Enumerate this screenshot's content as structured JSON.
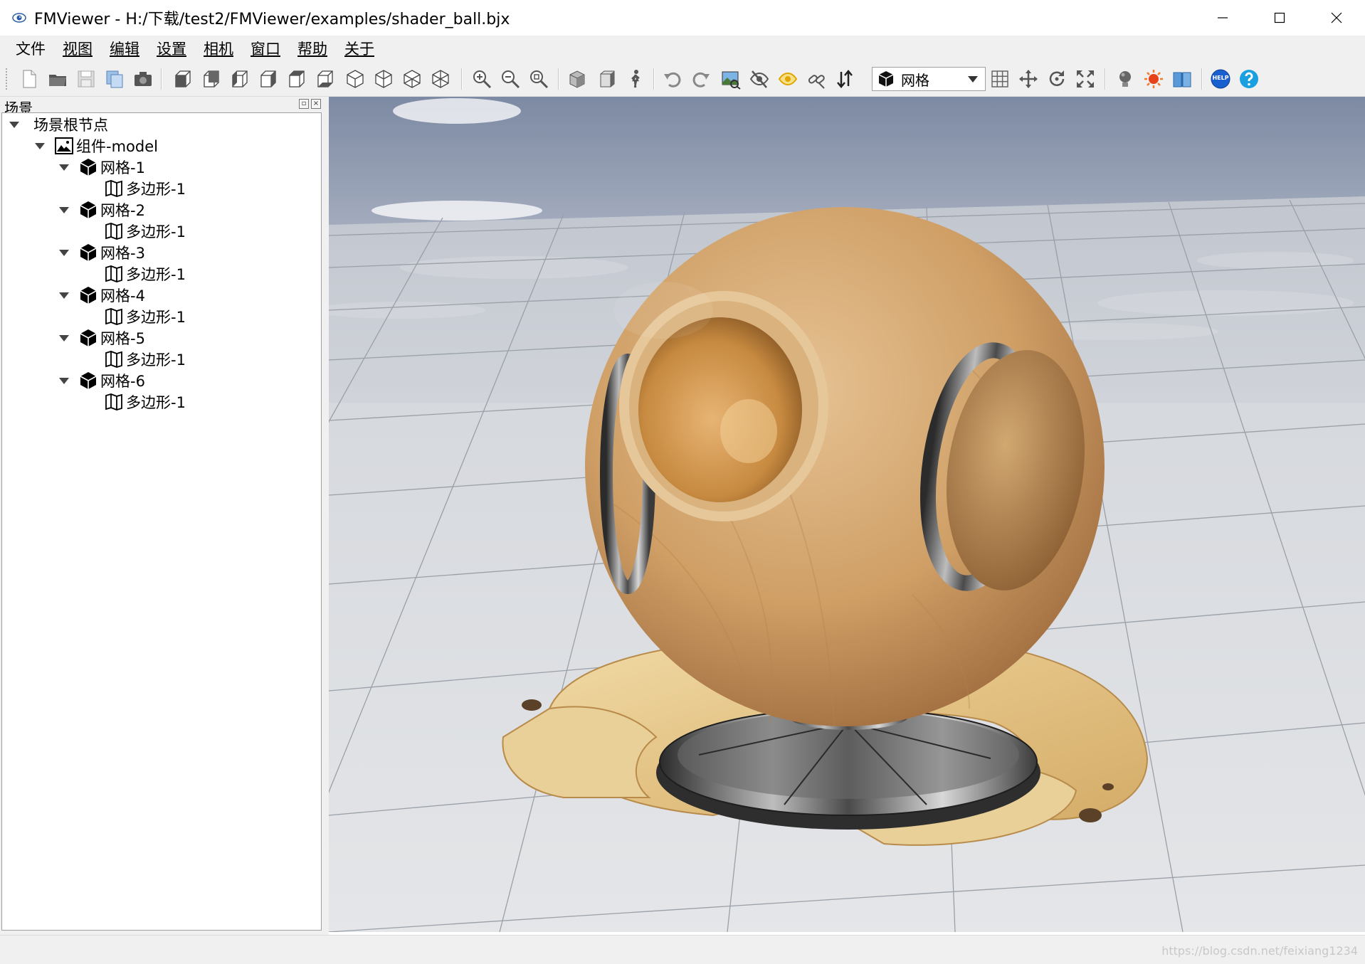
{
  "window": {
    "title": "FMViewer - H:/下载/test2/FMViewer/examples/shader_ball.bjx",
    "controls": [
      "minimize",
      "maximize",
      "close"
    ]
  },
  "menu": [
    {
      "label": "文件",
      "icon": null
    },
    {
      "label": "视图",
      "icon": null
    },
    {
      "label": "编辑",
      "icon": null
    },
    {
      "label": "设置",
      "icon": null
    },
    {
      "label": "相机",
      "icon": null
    },
    {
      "label": "窗口",
      "icon": null
    },
    {
      "label": "帮助",
      "icon": null
    },
    {
      "label": "关于",
      "icon": null
    }
  ],
  "toolbar": {
    "file_tools": [
      "new-file-icon",
      "open-folder-icon",
      "save-icon",
      "copy-icon",
      "screenshot-icon"
    ],
    "view_tools": [
      "view-front-icon",
      "view-back-icon",
      "view-left-icon",
      "view-right-icon",
      "view-top-icon",
      "view-bottom-icon",
      "view-iso-1-icon",
      "view-iso-2-icon",
      "view-iso-3-icon",
      "view-iso-4-icon"
    ],
    "zoom_tools": [
      "zoom-in-icon",
      "zoom-out-icon",
      "zoom-fit-icon"
    ],
    "mode_select": {
      "label": "网格",
      "icon": "mesh-cube-icon"
    },
    "help_badge": "HELP"
  },
  "scene_panel": {
    "title": "场景",
    "tree": [
      {
        "level": 0,
        "label": "场景根节点",
        "icon": null,
        "expanded": true
      },
      {
        "level": 1,
        "label": "组件-model",
        "icon": "image-icon",
        "expanded": true
      },
      {
        "level": 2,
        "label": "网格-1",
        "icon": "cube-icon",
        "expanded": true
      },
      {
        "level": 3,
        "label": "多边形-1",
        "icon": "map-icon"
      },
      {
        "level": 2,
        "label": "网格-2",
        "icon": "cube-icon",
        "expanded": true
      },
      {
        "level": 3,
        "label": "多边形-1",
        "icon": "map-icon"
      },
      {
        "level": 2,
        "label": "网格-3",
        "icon": "cube-icon",
        "expanded": true
      },
      {
        "level": 3,
        "label": "多边形-1",
        "icon": "map-icon"
      },
      {
        "level": 2,
        "label": "网格-4",
        "icon": "cube-icon",
        "expanded": true
      },
      {
        "level": 3,
        "label": "多边形-1",
        "icon": "map-icon"
      },
      {
        "level": 2,
        "label": "网格-5",
        "icon": "cube-icon",
        "expanded": true
      },
      {
        "level": 3,
        "label": "多边形-1",
        "icon": "map-icon"
      },
      {
        "level": 2,
        "label": "网格-6",
        "icon": "cube-icon",
        "expanded": true
      },
      {
        "level": 3,
        "label": "多边形-1",
        "icon": "map-icon"
      }
    ]
  },
  "statusbar": {
    "watermark": "https://blog.csdn.net/feixiang1234"
  },
  "colors": {
    "wood": "#d2a46a",
    "wood_dark": "#a87a44",
    "base_wood": "#e8cf9a",
    "chrome": "#5a5a5a",
    "sky": "#8a96ae",
    "ground": "#d4d7dc",
    "grid": "#9aa0a8"
  }
}
